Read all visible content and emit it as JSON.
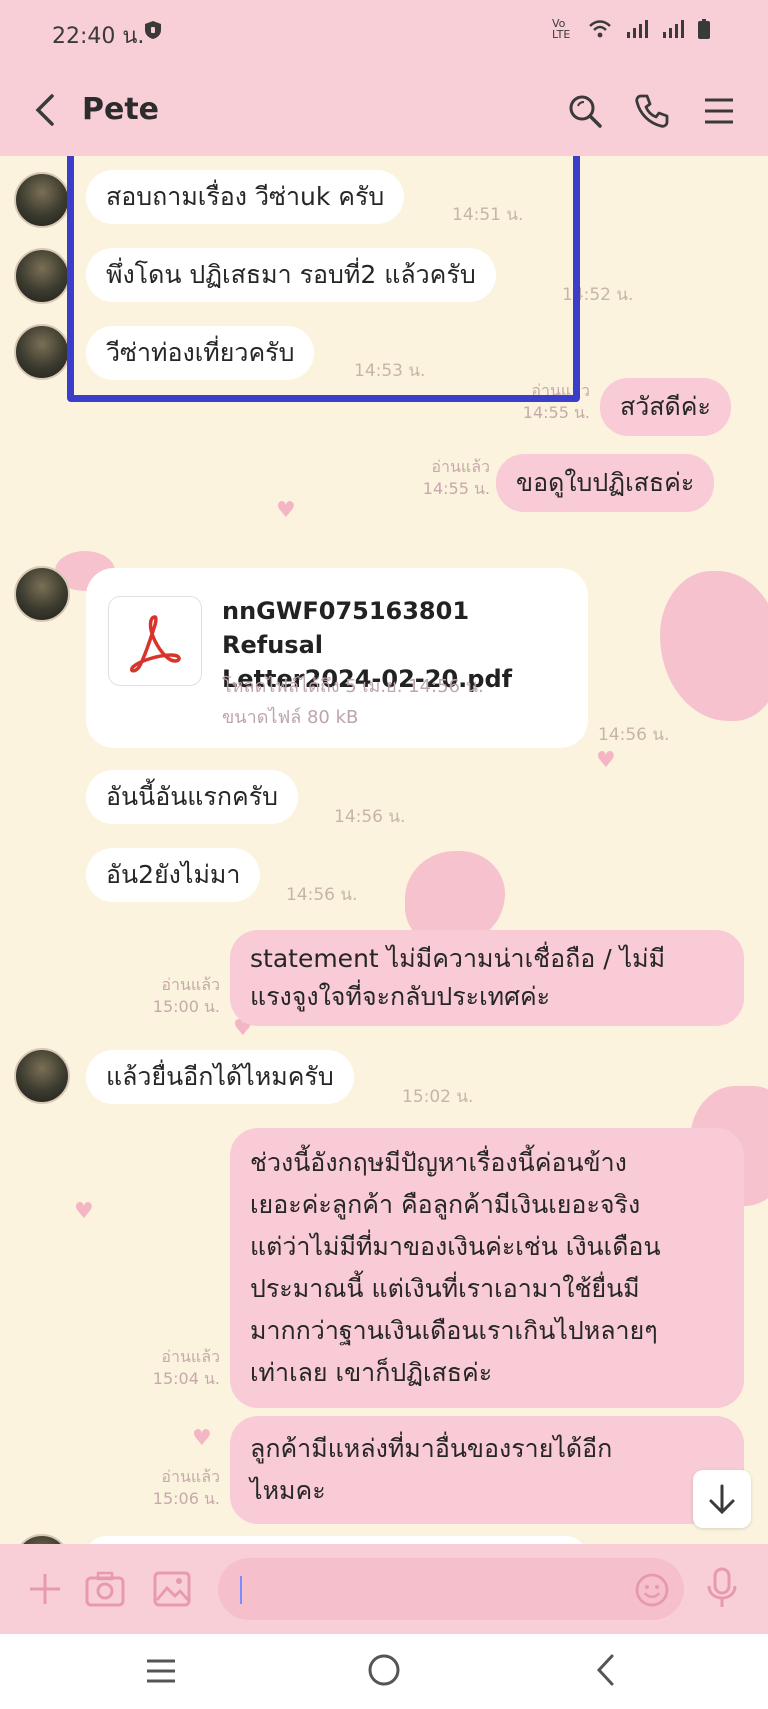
{
  "status_bar": {
    "time": "22:40 น.",
    "network": "Vo LTE"
  },
  "header": {
    "contact_name": "Pete"
  },
  "messages": [
    {
      "text": "สอบถามเรื่อง วีซ่าuk ครับ",
      "time": "14:51 น."
    },
    {
      "text": "พึ่งโดน ปฏิเสธมา รอบที่2 แล้วครับ",
      "time": "14:52 น."
    },
    {
      "text": "วีซ่าท่องเที่ยวครับ",
      "time": "14:53 น."
    },
    {
      "text": "สวัสดีค่ะ",
      "read": "อ่านแล้ว",
      "time": "14:55 น."
    },
    {
      "text": "ขอดูใบปฏิเสธค่ะ",
      "read": "อ่านแล้ว",
      "time": "14:55 น."
    },
    {
      "text": "อันนี้อันแรกครับ",
      "time": "14:56 น."
    },
    {
      "text": "อัน2ยังไม่มา",
      "time": "14:56 น."
    },
    {
      "lines": [
        "statement ไม่มีความน่าเชื่อถือ / ไม่มี",
        "แรงจูงใจที่จะกลับประเทศค่ะ"
      ],
      "read": "อ่านแล้ว",
      "time": "15:00 น."
    },
    {
      "text": "แล้วยื่นอีกได้ไหมครับ",
      "time": "15:02 น."
    },
    {
      "lines": [
        "ช่วงนี้อังกฤษมีปัญหาเรื่องนี้ค่อนข้าง",
        "เยอะค่ะลูกค้า คือลูกค้ามีเงินเยอะจริง",
        "แต่ว่าไม่มีที่มาของเงินค่ะเช่น เงินเดือน",
        "ประมาณนี้ แต่เงินที่เราเอามาใช้ยื่นมี",
        "มากกว่าฐานเงินเดือนเราเกินไปหลายๆ",
        "เท่าเลย เขาก็ปฏิเสธค่ะ"
      ],
      "read": "อ่านแล้ว",
      "time": "15:04 น."
    },
    {
      "lines": [
        "ลูกค้ามีแหล่งที่มาอื่นของรายได้อีก",
        "ไหมคะ"
      ],
      "read": "อ่านแล้ว",
      "time": "15:06 น."
    }
  ],
  "file_message": {
    "name_line1": "nnGWF075163801 Refusal",
    "name_line2": "Letter2024-02-20.pdf",
    "download_note": "โหลดไฟล์ได้ถึง 5 เม.ย. 14:56 น.",
    "size_note": "ขนาดไฟล์ 80 kB",
    "time": "14:56 น."
  },
  "colors": {
    "header_bg": "#f9cfd7",
    "chat_bg": "#fbf3de",
    "outgoing_bubble": "#f9cbd6",
    "incoming_bubble": "#ffffff",
    "highlight_border": "#3b3ec9",
    "pdf_red": "#d9342b"
  }
}
